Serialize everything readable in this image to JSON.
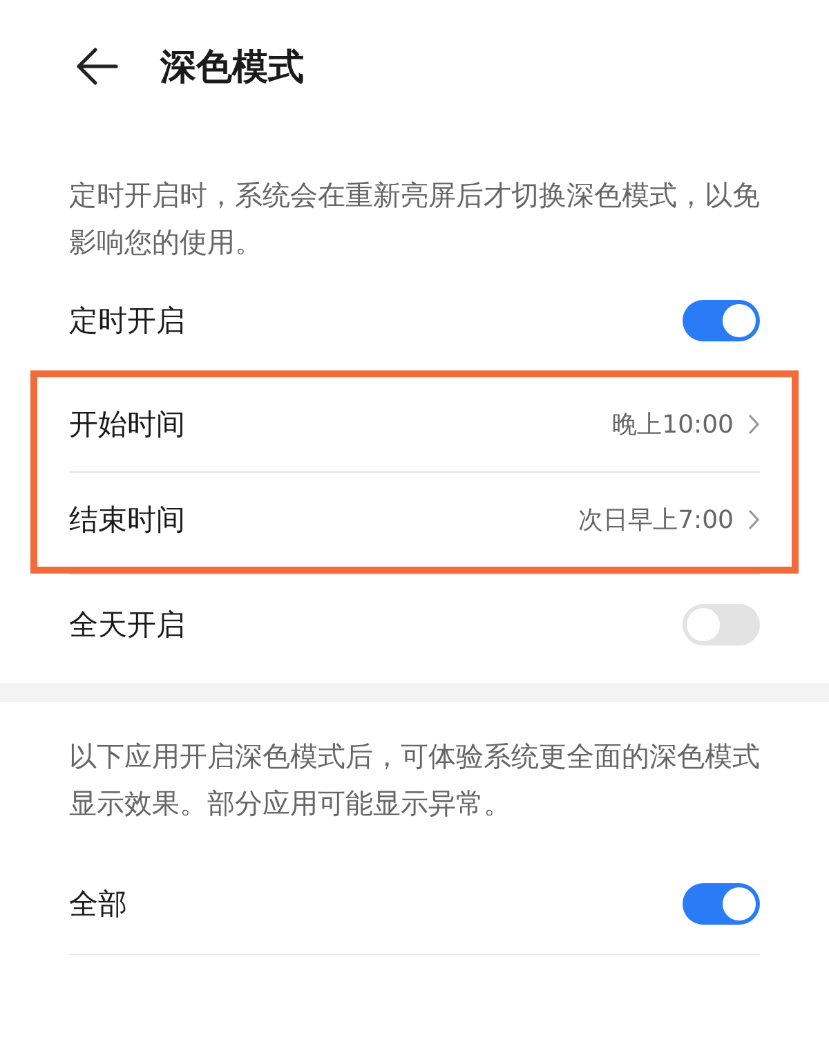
{
  "header": {
    "title": "深色模式"
  },
  "sections": [
    {
      "note": "定时开启时，系统会在重新亮屏后才切换深色模式，以免影响您的使用。",
      "groups": [
        {
          "highlighted": false,
          "rows": [
            {
              "kind": "toggle",
              "label": "定时开启",
              "on": true
            }
          ]
        },
        {
          "highlighted": true,
          "rows": [
            {
              "kind": "link",
              "label": "开始时间",
              "value": "晚上10:00"
            },
            {
              "kind": "link",
              "label": "结束时间",
              "value": "次日早上7:00"
            }
          ]
        },
        {
          "highlighted": false,
          "rows": [
            {
              "kind": "toggle",
              "label": "全天开启",
              "on": false
            }
          ]
        }
      ]
    },
    {
      "note": "以下应用开启深色模式后，可体验系统更全面的深色模式显示效果。部分应用可能显示异常。",
      "groups": [
        {
          "highlighted": false,
          "rows": [
            {
              "kind": "toggle",
              "label": "全部",
              "on": true
            }
          ]
        }
      ]
    }
  ]
}
